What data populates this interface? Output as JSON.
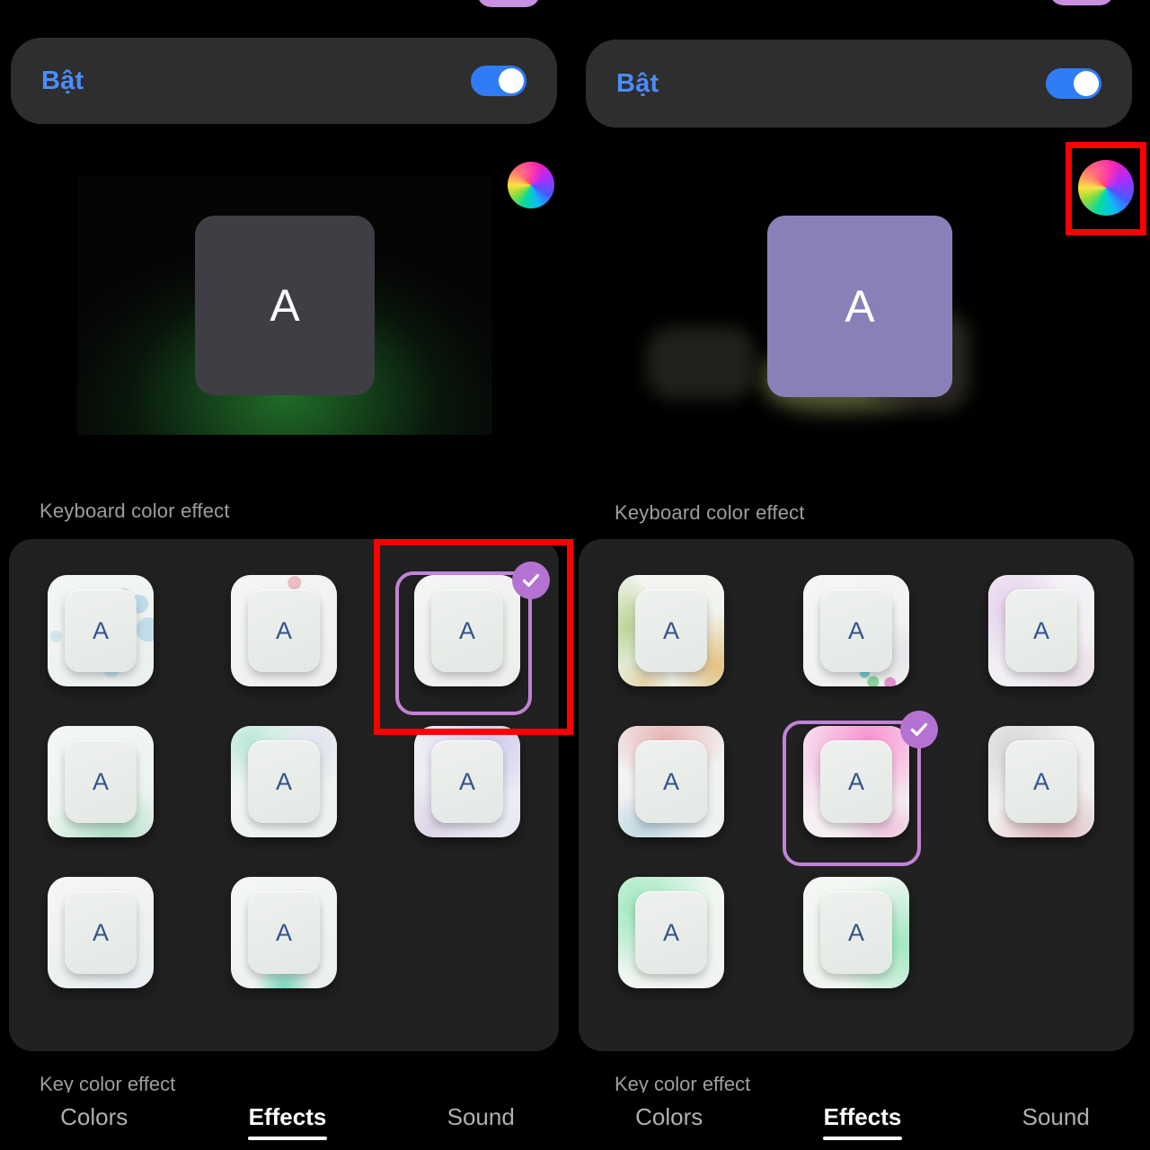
{
  "panels": [
    {
      "id": "left",
      "toggle": {
        "label": "Bật",
        "state_on": true
      },
      "color_wheel": {
        "name": "color-wheel-icon"
      },
      "preview": {
        "key_letter": "A",
        "key_color": "#3e3e44",
        "glow_color": "#24782e"
      },
      "section_label": "Keyboard color effect",
      "bottom_label": "Key color effect",
      "grid": {
        "selected_index": 2,
        "items": [
          {
            "letter": "A",
            "tint": "blue-bubbles"
          },
          {
            "letter": "A",
            "tint": "pink-dot"
          },
          {
            "letter": "A",
            "tint": "plain"
          },
          {
            "letter": "A",
            "tint": "mint"
          },
          {
            "letter": "A",
            "tint": "teal"
          },
          {
            "letter": "A",
            "tint": "lavender"
          },
          {
            "letter": "A",
            "tint": "pale"
          },
          {
            "letter": "A",
            "tint": "green-drop"
          }
        ]
      },
      "tabs": [
        {
          "label": "Colors",
          "active": false
        },
        {
          "label": "Effects",
          "active": true
        },
        {
          "label": "Sound",
          "active": false
        }
      ]
    },
    {
      "id": "right",
      "toggle": {
        "label": "Bật",
        "state_on": true
      },
      "color_wheel": {
        "name": "color-wheel-icon"
      },
      "preview": {
        "key_letter": "A",
        "key_color": "#8a80b8",
        "glow_color": "#96a05a"
      },
      "section_label": "Keyboard color effect",
      "bottom_label": "Key color effect",
      "grid": {
        "selected_index": 4,
        "items": [
          {
            "letter": "A",
            "tint": "olive-gold"
          },
          {
            "letter": "A",
            "tint": "confetti"
          },
          {
            "letter": "A",
            "tint": "lilac"
          },
          {
            "letter": "A",
            "tint": "rose-blue"
          },
          {
            "letter": "A",
            "tint": "pink"
          },
          {
            "letter": "A",
            "tint": "mauve"
          },
          {
            "letter": "A",
            "tint": "green"
          },
          {
            "letter": "A",
            "tint": "green-right"
          }
        ]
      },
      "tabs": [
        {
          "label": "Colors",
          "active": false
        },
        {
          "label": "Effects",
          "active": true
        },
        {
          "label": "Sound",
          "active": false
        }
      ]
    }
  ],
  "annotations": {
    "accent_color": "#ff0000",
    "boxes": [
      {
        "name": "color-wheel-highlight",
        "panel": "right"
      },
      {
        "name": "selected-effect-highlight",
        "panel": "left"
      }
    ]
  },
  "colors": {
    "toggle_on": "#2f7cf6",
    "toggle_label": "#4b8dfd",
    "selection_ring": "#c183d6",
    "check_badge": "#b473d2",
    "card_bg": "#2e2e2e",
    "grid_bg": "#212121",
    "label_gray": "#9e9e9e"
  }
}
